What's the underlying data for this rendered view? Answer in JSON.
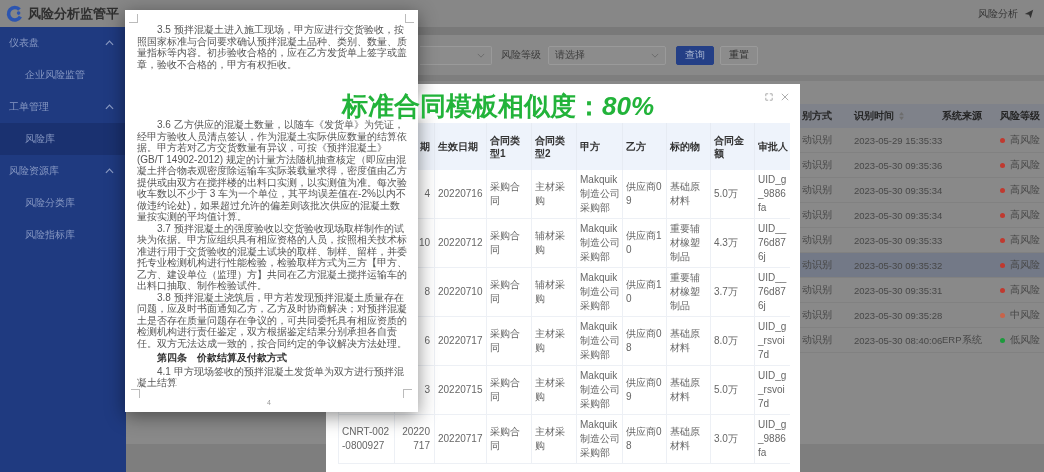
{
  "header": {
    "title": "风险分析监管平",
    "user_menu": "风险分析"
  },
  "sidebar": {
    "groups": [
      {
        "label": "仪表盘",
        "expanded": true,
        "children": [
          {
            "label": "企业风险监管",
            "selected": false
          }
        ]
      },
      {
        "label": "工单管理",
        "expanded": true,
        "children": [
          {
            "label": "风险库",
            "selected": true
          }
        ]
      },
      {
        "label": "风险资源库",
        "expanded": true,
        "children": [
          {
            "label": "风险分类库",
            "selected": false
          },
          {
            "label": "风险指标库",
            "selected": false
          }
        ]
      }
    ]
  },
  "filter": {
    "fields": [
      {
        "kind": "select"
      },
      {
        "kind": "select",
        "label": "风险等级",
        "placeholder": "请选择"
      }
    ],
    "buttons": [
      {
        "label": "查询",
        "primary": true
      },
      {
        "label": "重置",
        "primary": false
      }
    ]
  },
  "risk_table": {
    "columns": [
      {
        "label": "别方式",
        "sortable": false
      },
      {
        "label": "识别时间",
        "sortable": true
      },
      {
        "label": "系统来源",
        "sortable": false
      },
      {
        "label": "风险等级",
        "sortable": false
      }
    ],
    "rows": [
      {
        "method": "动识别",
        "time": "2023-05-29 15:35:33",
        "level": "高风险",
        "color": "#c0392f",
        "selected": false
      },
      {
        "method": "动识别",
        "time": "2023-05-30 09:35:36",
        "level": "高风险",
        "color": "#c0392f",
        "selected": false
      },
      {
        "method": "动识别",
        "time": "2023-05-30 09:35:34",
        "level": "高风险",
        "color": "#c0392f",
        "selected": false
      },
      {
        "method": "动识别",
        "time": "2023-05-30 09:35:34",
        "level": "高风险",
        "color": "#c0392f",
        "selected": false
      },
      {
        "method": "动识别",
        "time": "2023-05-30 09:35:33",
        "level": "高风险",
        "color": "#c0392f",
        "selected": false
      },
      {
        "method": "动识别",
        "time": "2023-05-30 09:35:32",
        "level": "高风险",
        "color": "#c0392f",
        "selected": true
      },
      {
        "method": "动识别",
        "time": "2023-05-30 09:35:31",
        "level": "高风险",
        "color": "#c0392f",
        "selected": false
      },
      {
        "method": "动识别",
        "time": "2023-05-30 09:35:28",
        "level": "中风险",
        "color": "#c8644a",
        "selected": false
      },
      {
        "method": "动识别",
        "time": "2023-05-30 08:40:06",
        "source": "ERP系统",
        "level": "低风险",
        "color": "#1c9a3c",
        "selected": false
      }
    ]
  },
  "contract_dialog": {
    "similarity": "标准合同模板相似度：*80%*",
    "columns": [
      "期",
      "生效日期",
      "合同类型1",
      "合同类型2",
      "甲方",
      "乙方",
      "标的物",
      "合同金额",
      "审批人"
    ],
    "rows": [
      {
        "sign_date": "4",
        "effective_date": "20220716",
        "type_1": "采购合同",
        "type_2": "主材采购",
        "party_a": "Makquik制造公司采购部",
        "party_b": "供应商09",
        "subject": "基础原材料",
        "amount": "5.0万",
        "approver": "UID_g_9886fa"
      },
      {
        "sign_date": "10",
        "effective_date": "20220712",
        "type_1": "采购合同",
        "type_2": "辅材采购",
        "party_a": "Makquik制造公司采购部",
        "party_b": "供应商10",
        "subject": "重要辅材橡塑制品",
        "amount": "4.3万",
        "approver": "UID__76d876j"
      },
      {
        "sign_date": "8",
        "effective_date": "20220710",
        "type_1": "采购合同",
        "type_2": "辅材采购",
        "party_a": "Makquik制造公司采购部",
        "party_b": "供应商10",
        "subject": "重要辅材橡塑制品",
        "amount": "3.7万",
        "approver": "UID__76d876j"
      },
      {
        "sign_date": "6",
        "effective_date": "20220717",
        "type_1": "采购合同",
        "type_2": "主材采购",
        "party_a": "Makquik制造公司采购部",
        "party_b": "供应商08",
        "subject": "基础原材料",
        "amount": "8.0万",
        "approver": "UID_g_rsvoi7d"
      },
      {
        "sign_date": "3",
        "effective_date": "20220715",
        "type_1": "采购合同",
        "type_2": "主材采购",
        "party_a": "Makquik制造公司采购部",
        "party_b": "供应商09",
        "subject": "基础原材料",
        "amount": "5.0万",
        "approver": "UID_g_rsvoi7d"
      },
      {
        "contract_no": "CNRT-002-0800927",
        "sign_date": "20220717",
        "effective_date": "20220717",
        "type_1": "采购合同",
        "type_2": "主材采购",
        "party_a": "Makquik制造公司采购部",
        "party_b": "供应商08",
        "subject": "基础原材料",
        "amount": "3.0万",
        "approver": "UID_g_9886fa"
      }
    ]
  },
  "document": {
    "paragraphs": [
      {
        "kind": "text",
        "text": "3.5 预拌混凝土进入施工现场，甲方应进行交货验收，按照国家标准与合同要求确认预拌混凝土品种、类别、数量、质量指标等内容。初步验收合格的，应在乙方发货单上签字或盖章，验收不合格的，甲方有权拒收。"
      },
      {
        "kind": "text",
        "text": "3.6 乙方供应的混凝土数量，以随车《发货单》为凭证，经甲方验收人员清点签认，作为混凝土实际供应数量的结算依据。甲方若对乙方交货数量有异议，可按《预拌混凝土》(GB/T 14902-2012) 规定的计量方法随机抽查核定（即应由混凝土拌合物表观密度除运输车实际装载量求得，密度值由乙方提供或由双方在搅拌楼的出料口实测，以实测值为准。每次验收车数以不少于 3 车为一个单位，其平均误差值在-2%以内不做违约论处)，如果超过允许的偏差则该批次供应的混凝土数量按实测的平均值计算。"
      },
      {
        "kind": "text",
        "text": "3.7 预拌混凝土的强度验收以交货验收现场取样制作的试块为依据。甲方应组织具有相应资格的人员，按照相关技术标准进行用于交货验收的混凝土试块的取样、制样、留样，并委托专业检测机构进行性能检验，检验取样方式为三方【甲方、乙方、建设单位（监理）方】共同在乙方混凝土搅拌运输车的出料口抽取、制作检验试件。"
      },
      {
        "kind": "text",
        "text": "3.8 预拌混凝土浇筑后，甲方若发现预拌混凝土质量存在问题，应及时书面通知乙方，乙方及时协商解决；对预拌混凝土是否存在质量问题存在争议的，可共同委托具有相应资质的检测机构进行责任鉴定，双方根据鉴定结果分别承担各自责任。双方无法达成一致的，按合同约定的争议解决方法处理。"
      },
      {
        "kind": "heading",
        "text": "第四条　价款结算及付款方式"
      },
      {
        "kind": "text",
        "text": "4.1 甲方现场签收的预拌混凝土发货单为双方进行预拌混凝土结算"
      }
    ],
    "page_number": "4"
  }
}
